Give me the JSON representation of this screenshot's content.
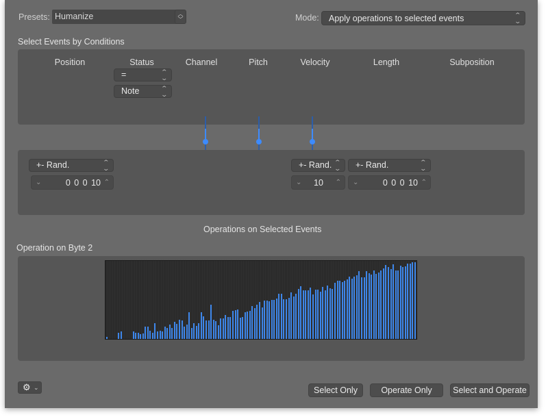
{
  "header": {
    "presets_label": "Presets:",
    "presets_value": "Humanize",
    "mode_label": "Mode:",
    "mode_value": "Apply operations to selected events"
  },
  "conditions": {
    "title": "Select Events by Conditions",
    "columns": [
      "Position",
      "Status",
      "Channel",
      "Pitch",
      "Velocity",
      "Length",
      "Subposition"
    ],
    "status_operator": "=",
    "status_value": "Note"
  },
  "operations": {
    "title": "Operations on Selected Events",
    "position": {
      "operation": "+- Rand.",
      "value": "0 0 0   10"
    },
    "velocity": {
      "operation": "+- Rand.",
      "value": "10"
    },
    "length": {
      "operation": "+- Rand.",
      "value": "0 0 0   10"
    }
  },
  "byte2": {
    "title": "Operation on Byte 2"
  },
  "colors": {
    "accent": "#3d86ea",
    "window_bg": "#6a6a6a",
    "panel_bg": "#565656"
  },
  "footer": {
    "gear_label": "Action menu",
    "select_only": "Select Only",
    "operate_only": "Operate Only",
    "select_and_operate": "Select and Operate"
  },
  "chart_data": {
    "type": "bar",
    "title": "Operation on Byte 2",
    "xlabel": "",
    "ylabel": "",
    "xlim": [
      0,
      127
    ],
    "ylim": [
      0,
      127
    ],
    "grid": false,
    "description": "Velocity mapping curve (128 input values), randomized around a linear ramp",
    "values": [
      3,
      0,
      0,
      0,
      0,
      10,
      12,
      0,
      0,
      0,
      0,
      12,
      10,
      10,
      8,
      9,
      20,
      21,
      14,
      10,
      26,
      12,
      14,
      12,
      21,
      18,
      24,
      18,
      28,
      25,
      32,
      31,
      21,
      24,
      44,
      18,
      26,
      22,
      26,
      44,
      38,
      31,
      31,
      57,
      32,
      30,
      23,
      34,
      34,
      40,
      36,
      36,
      46,
      48,
      49,
      35,
      36,
      44,
      45,
      46,
      55,
      51,
      57,
      61,
      52,
      63,
      63,
      62,
      65,
      65,
      67,
      75,
      75,
      66,
      66,
      68,
      77,
      70,
      75,
      83,
      87,
      80,
      80,
      80,
      85,
      74,
      82,
      82,
      78,
      86,
      81,
      88,
      84,
      83,
      93,
      96,
      97,
      94,
      96,
      99,
      103,
      100,
      103,
      106,
      112,
      102,
      102,
      112,
      109,
      107,
      114,
      108,
      110,
      114,
      117,
      122,
      119,
      116,
      124,
      114,
      113,
      121,
      119,
      120,
      125,
      125,
      127,
      127
    ]
  }
}
